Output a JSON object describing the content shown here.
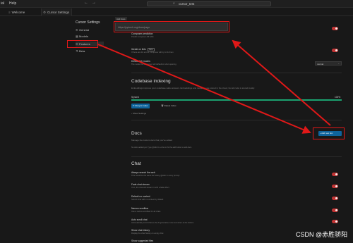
{
  "titlebar": {
    "menus": [
      "ial",
      "Help"
    ],
    "back_glyph": "←",
    "forward_glyph": "→",
    "search_icon": "search-icon",
    "search_text": "cursor_test"
  },
  "tabs": [
    {
      "label": "Welcome",
      "icon": "file-icon",
      "active": false
    },
    {
      "label": "Cursor Settings",
      "icon": "gear-icon",
      "active": true
    }
  ],
  "left_nav": {
    "title": "Cursor Settings",
    "items": [
      {
        "label": "General",
        "icon": "gear-icon",
        "selected": false
      },
      {
        "label": "Models",
        "icon": "models-icon",
        "selected": false
      },
      {
        "label": "Features",
        "icon": "features-icon",
        "selected": true
      },
      {
        "label": "Beta",
        "icon": "flask-icon",
        "selected": false
      }
    ]
  },
  "top_section": {
    "input_badge": "Add docs",
    "input_placeholder": "https://pytorch.org/docs/page",
    "rows": [
      {
        "title": "Composer prediction",
        "desc": "Predict composer diff edits",
        "toggle": true
      },
      {
        "title": "Iterate on lints",
        "beta": "Beta",
        "desc": "If there are lint errors, composer will try to fix them",
        "toggle": true
      },
      {
        "title": "Default tab modes",
        "desc": "The mode that composer will default to when opening",
        "select": "normal"
      }
    ]
  },
  "codebase": {
    "title": "Codebase indexing",
    "desc": "Embeddings improve your codebase-wide answers. Embeddings and metadata are stored in the cloud, but all code is stored locally.",
    "status": "Synced",
    "progress_pct_text": "100%",
    "progress_fraction": 1.0,
    "resync_label": "Resync Index",
    "delete_label": "Delete Index",
    "show_settings": "Show Settings",
    "accent_color": "#1aa370"
  },
  "docs": {
    "title": "Docs",
    "desc": "Manage the custom docs that you've added",
    "empty_text": "No docs added yet. Type @Add in a chat or hit the add button to add docs.",
    "add_button": "+ Add new doc"
  },
  "chat": {
    "title": "Chat",
    "rows": [
      {
        "title": "Always search the web",
        "desc": "This would be the same as having @web in every prompt",
        "toggle": true
      },
      {
        "title": "Fade chat stream",
        "desc": "If on, the chat will stream in with a fade effect",
        "toggle": true
      },
      {
        "title": "Default no context",
        "desc": "Submit chat with no context by default",
        "toggle": true
      },
      {
        "title": "Narrow scrollbar",
        "desc": "Use a narrow scrollbar for all chats",
        "toggle": true
      },
      {
        "title": "Auto scroll chat",
        "desc": "Automatically scroll chat as the AI generates more text when at the bottom",
        "toggle": true
      },
      {
        "title": "Show chat history",
        "desc": "Display the chat history on empty chat",
        "toggle": true
      },
      {
        "title": "Show suggested files",
        "desc": "",
        "toggle": false
      }
    ]
  },
  "colors": {
    "annotation": "#e01818",
    "toggle_on": "#c13333",
    "button_blue": "#0e639c"
  },
  "watermark": "CSDN @赤胜骄阳"
}
